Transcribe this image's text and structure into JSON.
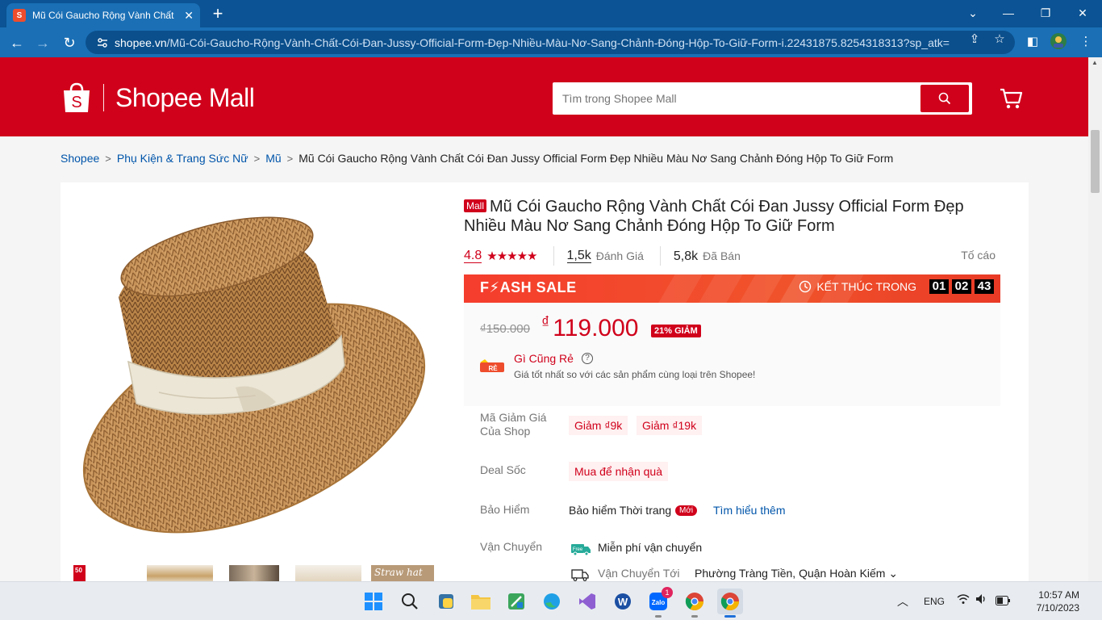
{
  "browser": {
    "tab_title": "Mũ Cói Gaucho Rộng Vành Chất",
    "url_domain": "shopee.vn",
    "url_path": "/Mũ-Cói-Gaucho-Rộng-Vành-Chất-Cói-Đan-Jussy-Official-Form-Đẹp-Nhiều-Màu-Nơ-Sang-Chảnh-Đóng-Hộp-To-Giữ-Form-i.22431875.8254318313?sp_atk="
  },
  "header": {
    "logo_text": "Shopee Mall",
    "search_placeholder": "Tìm trong Shopee Mall"
  },
  "breadcrumb": [
    {
      "label": "Shopee",
      "link": true
    },
    {
      "label": "Phụ Kiện & Trang Sức Nữ",
      "link": true
    },
    {
      "label": "Mũ",
      "link": true
    },
    {
      "label": "Mũ Cói Gaucho Rộng Vành Chất Cói Đan Jussy Official Form Đẹp Nhiều Màu Nơ Sang Chảnh Đóng Hộp To Giữ Form",
      "link": false
    }
  ],
  "product": {
    "mall_badge": "Mall",
    "title": "Mũ Cói Gaucho Rộng Vành Chất Cói Đan Jussy Official Form Đẹp Nhiều Màu Nơ Sang Chảnh Đóng Hộp To Giữ Form",
    "rating": "4.8",
    "rating_stars": 5,
    "reviews_count": "1,5k",
    "reviews_label": "Đánh Giá",
    "sold_count": "5,8k",
    "sold_label": "Đã Bán",
    "report_label": "Tố cáo",
    "thumb_badge": "50",
    "thumb_caption": "Straw hat"
  },
  "flash_sale": {
    "title": "F⚡ASH SALE",
    "ends_label": "KẾT THÚC TRONG",
    "hours": "01",
    "minutes": "02",
    "seconds": "43"
  },
  "pricing": {
    "original_price": "₫150.000",
    "currency": "₫",
    "current_price": "119.000",
    "discount_badge": "21% GIẢM",
    "cheap_icon_text": "RẺ",
    "cheap_title": "Gì Cũng Rẻ",
    "cheap_desc": "Giá tốt nhất so với các sản phẩm cùng loại trên Shopee!"
  },
  "details": {
    "voucher_label": "Mã Giảm Giá Của Shop",
    "vouchers": [
      "Giảm ₫9k",
      "Giảm ₫19k"
    ],
    "deal_label": "Deal Sốc",
    "deal_value": "Mua để nhận quà",
    "insurance_label": "Bảo Hiểm",
    "insurance_value": "Bảo hiểm Thời trang",
    "insurance_new": "Mới",
    "learn_more": "Tìm hiểu thêm",
    "shipping_label": "Vận Chuyển",
    "free_ship_badge": "Free",
    "free_shipping": "Miễn phí vận chuyển",
    "ship_to_label": "Vận Chuyển Tới",
    "ship_to": "Phường Tràng Tiền, Quận Hoàn Kiếm"
  },
  "taskbar": {
    "language": "ENG",
    "time": "10:57 AM",
    "date": "7/10/2023",
    "zalo_badge": "1",
    "zalo_label": "Zalo"
  },
  "colors": {
    "brand_red": "#d0011b",
    "chrome_blue": "#1a6fb5",
    "link_blue": "#0055aa",
    "flash_orange": "#f53d2d"
  }
}
